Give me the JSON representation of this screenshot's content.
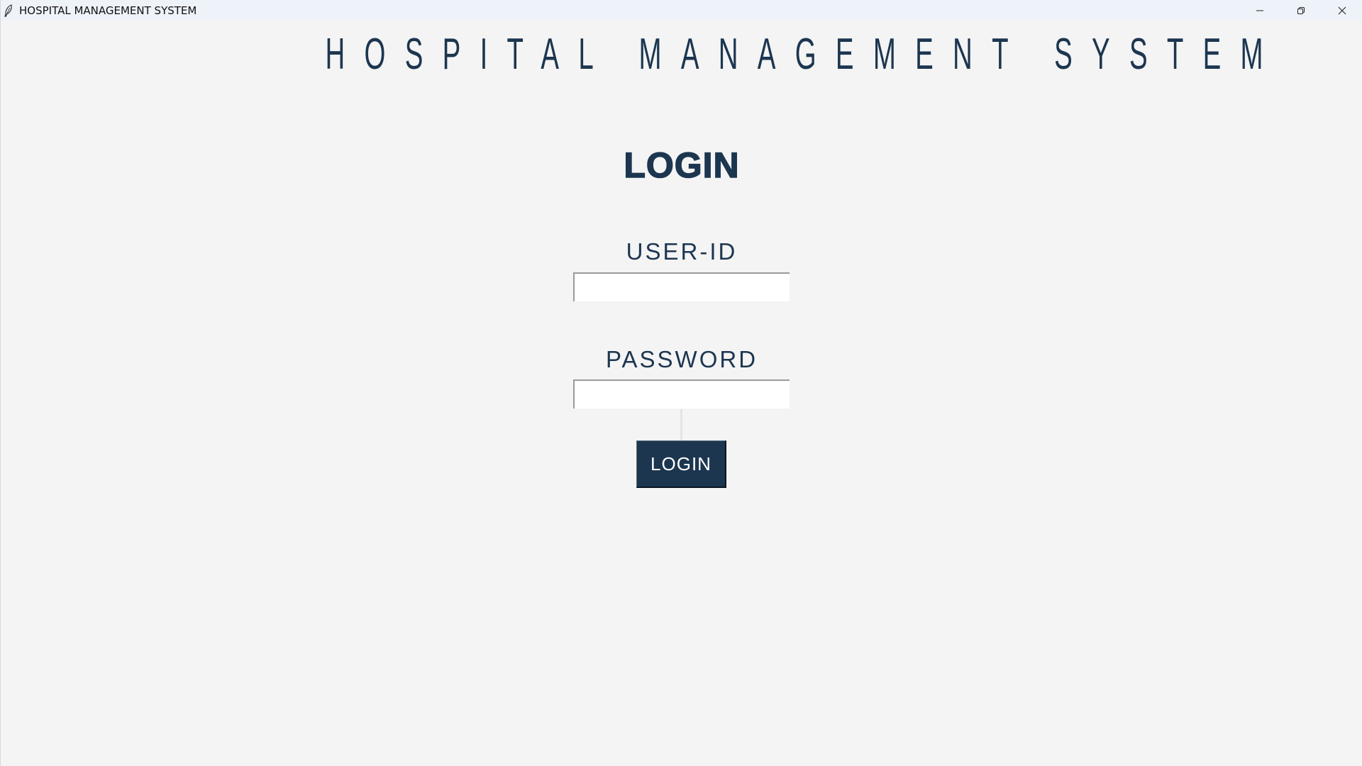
{
  "window": {
    "title": "HOSPITAL MANAGEMENT SYSTEM",
    "app_icon": "feather-icon",
    "controls": {
      "minimize_icon": "minimize-icon",
      "maximize_icon": "restore-icon",
      "close_icon": "close-icon"
    }
  },
  "header": {
    "title": "HOSPITAL MANAGEMENT SYSTEM"
  },
  "login": {
    "title": "LOGIN",
    "user_id_label": "USER-ID",
    "user_id_value": "",
    "password_label": "PASSWORD",
    "password_value": "",
    "button_label": "LOGIN"
  },
  "colors": {
    "brand_navy": "#1c3650",
    "background": "#f4f4f4",
    "titlebar": "#eef2f9"
  }
}
